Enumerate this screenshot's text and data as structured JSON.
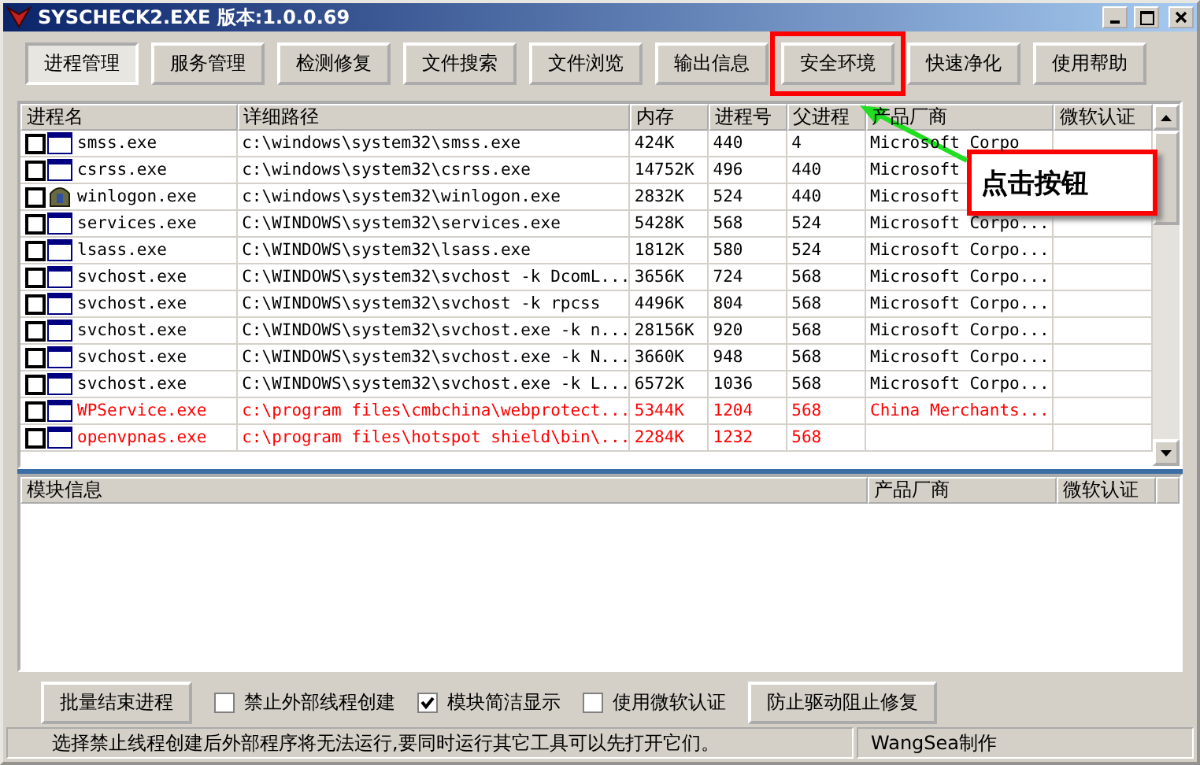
{
  "window": {
    "title": "SYSCHECK2.EXE  版本:1.0.0.69"
  },
  "toolbar": [
    {
      "label": "进程管理",
      "selected": true,
      "highlighted": false
    },
    {
      "label": "服务管理",
      "selected": false,
      "highlighted": false
    },
    {
      "label": "检测修复",
      "selected": false,
      "highlighted": false
    },
    {
      "label": "文件搜索",
      "selected": false,
      "highlighted": false
    },
    {
      "label": "文件浏览",
      "selected": false,
      "highlighted": false
    },
    {
      "label": "输出信息",
      "selected": false,
      "highlighted": false
    },
    {
      "label": "安全环境",
      "selected": false,
      "highlighted": true
    },
    {
      "label": "快速净化",
      "selected": false,
      "highlighted": false
    },
    {
      "label": "使用帮助",
      "selected": false,
      "highlighted": false
    }
  ],
  "process_table": {
    "columns": [
      "进程名",
      "详细路径",
      "内存",
      "进程号",
      "父进程",
      "产品厂商",
      "微软认证"
    ],
    "rows": [
      {
        "checked": false,
        "kind": "window",
        "flagged": false,
        "cells": [
          "smss.exe",
          "c:\\windows\\system32\\smss.exe",
          "424K",
          "440",
          "4",
          "Microsoft Corpo",
          ""
        ]
      },
      {
        "checked": false,
        "kind": "window",
        "flagged": false,
        "cells": [
          "csrss.exe",
          "c:\\windows\\system32\\csrss.exe",
          "14752K",
          "496",
          "440",
          "Microsoft",
          ""
        ]
      },
      {
        "checked": false,
        "kind": "emblem",
        "flagged": false,
        "cells": [
          "winlogon.exe",
          "c:\\windows\\system32\\winlogon.exe",
          "2832K",
          "524",
          "440",
          "Microsoft",
          ""
        ]
      },
      {
        "checked": false,
        "kind": "window",
        "flagged": false,
        "cells": [
          "services.exe",
          "C:\\WINDOWS\\system32\\services.exe",
          "5428K",
          "568",
          "524",
          "Microsoft Corpo...",
          ""
        ]
      },
      {
        "checked": false,
        "kind": "window",
        "flagged": false,
        "cells": [
          "lsass.exe",
          "C:\\WINDOWS\\system32\\lsass.exe",
          "1812K",
          "580",
          "524",
          "Microsoft Corpo...",
          ""
        ]
      },
      {
        "checked": false,
        "kind": "window",
        "flagged": false,
        "cells": [
          "svchost.exe",
          "C:\\WINDOWS\\system32\\svchost -k DcomL...",
          "3656K",
          "724",
          "568",
          "Microsoft Corpo...",
          ""
        ]
      },
      {
        "checked": false,
        "kind": "window",
        "flagged": false,
        "cells": [
          "svchost.exe",
          "C:\\WINDOWS\\system32\\svchost -k rpcss",
          "4496K",
          "804",
          "568",
          "Microsoft Corpo...",
          ""
        ]
      },
      {
        "checked": false,
        "kind": "window",
        "flagged": false,
        "cells": [
          "svchost.exe",
          "C:\\WINDOWS\\system32\\svchost.exe -k n...",
          "28156K",
          "920",
          "568",
          "Microsoft Corpo...",
          ""
        ]
      },
      {
        "checked": false,
        "kind": "window",
        "flagged": false,
        "cells": [
          "svchost.exe",
          "C:\\WINDOWS\\system32\\svchost.exe -k N...",
          "3660K",
          "948",
          "568",
          "Microsoft Corpo...",
          ""
        ]
      },
      {
        "checked": false,
        "kind": "window",
        "flagged": false,
        "cells": [
          "svchost.exe",
          "C:\\WINDOWS\\system32\\svchost.exe -k L...",
          "6572K",
          "1036",
          "568",
          "Microsoft Corpo...",
          ""
        ]
      },
      {
        "checked": false,
        "kind": "window",
        "flagged": true,
        "cells": [
          "WPService.exe",
          "c:\\program files\\cmbchina\\webprotect...",
          "5344K",
          "1204",
          "568",
          "China Merchants...",
          ""
        ]
      },
      {
        "checked": false,
        "kind": "window",
        "flagged": true,
        "cells": [
          "openvpnas.exe",
          "c:\\program files\\hotspot shield\\bin\\...",
          "2284K",
          "1232",
          "568",
          "",
          ""
        ]
      }
    ]
  },
  "callout": {
    "text": "点击按钮"
  },
  "module_table": {
    "columns": [
      "模块信息",
      "产品厂商",
      "微软认证"
    ]
  },
  "bottom_bar": [
    {
      "kind": "button",
      "label": "批量结束进程"
    },
    {
      "kind": "checkbox",
      "label": "禁止外部线程创建",
      "checked": false
    },
    {
      "kind": "checkbox",
      "label": "模块简洁显示",
      "checked": true
    },
    {
      "kind": "checkbox",
      "label": "使用微软认证",
      "checked": false
    },
    {
      "kind": "button",
      "label": "防止驱动阻止修复"
    }
  ],
  "status_bar": [
    "选择禁止线程创建后外部程序将无法运行,要同时运行其它工具可以先打开它们。",
    "WangSea制作"
  ]
}
